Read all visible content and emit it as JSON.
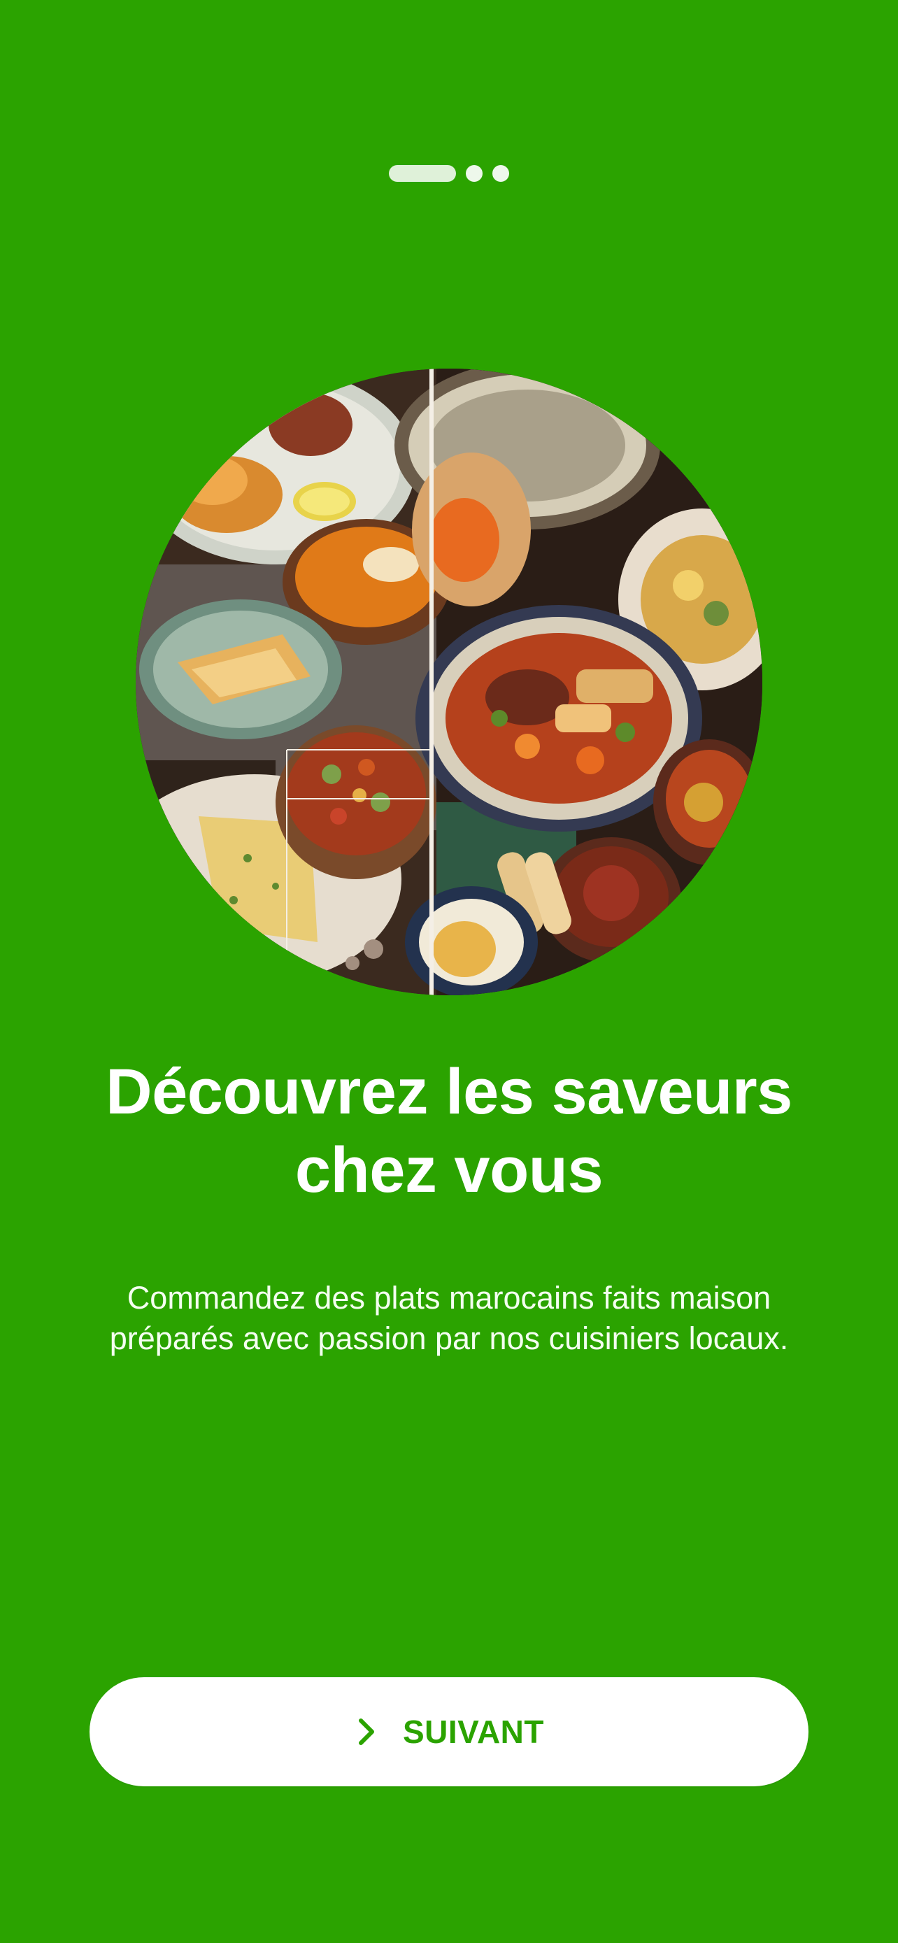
{
  "theme": {
    "background": "#2ba300",
    "accent": "#2ba300",
    "text": "#ffffff"
  },
  "onboarding": {
    "page_indicator": {
      "total": 3,
      "current": 1
    },
    "image": {
      "icon": "moroccan-dishes-collage"
    },
    "title": "Découvrez les saveurs chez vous",
    "subtitle": "Commandez des plats marocains faits maison préparés avec passion par nos cuisiniers locaux.",
    "next_button": {
      "label": "SUIVANT",
      "icon": "chevron-right-icon"
    }
  }
}
